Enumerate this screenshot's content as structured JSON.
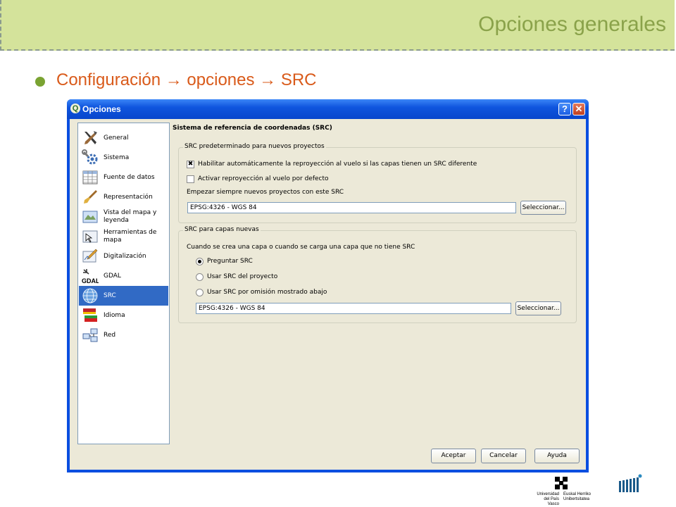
{
  "slide": {
    "title": "Opciones generales",
    "bullet": "Configuración → opciones → SRC",
    "colors": {
      "header_bg": "#d4e39b",
      "title": "#8aa24a",
      "bullet": "#d95a1a",
      "dot": "#7aa332"
    }
  },
  "window": {
    "title": "Opciones",
    "help_label": "?",
    "close_label": "✕"
  },
  "nav": {
    "items": [
      {
        "label": "General",
        "icon": "tools-icon"
      },
      {
        "label": "Sistema",
        "icon": "wrench-gear-icon"
      },
      {
        "label": "Fuente de datos",
        "icon": "table-icon"
      },
      {
        "label": "Representación",
        "icon": "brush-icon"
      },
      {
        "label": "Vista del mapa y leyenda",
        "icon": "map-view-icon"
      },
      {
        "label": "Herramientas de mapa",
        "icon": "map-tools-icon"
      },
      {
        "label": "Digitalización",
        "icon": "digitize-icon"
      },
      {
        "label": "GDAL",
        "icon": "gdal-icon"
      },
      {
        "label": "SRC",
        "icon": "globe-icon",
        "selected": true
      },
      {
        "label": "Idioma",
        "icon": "flags-icon"
      },
      {
        "label": "Red",
        "icon": "network-icon"
      }
    ]
  },
  "panel": {
    "section_title": "Sistema de referencia de coordenadas (SRC)",
    "group1": {
      "legend": "SRC predeterminado para nuevos proyectos",
      "checkbox1": {
        "label": "Habilitar automáticamente la reproyección al vuelo si las capas tienen un SRC diferente",
        "checked": true
      },
      "checkbox2": {
        "label": "Activar reproyección al vuelo por defecto",
        "checked": false
      },
      "field_label": "Empezar siempre nuevos proyectos con este SRC",
      "field_value": "EPSG:4326 - WGS 84",
      "select_button": "Seleccionar..."
    },
    "group2": {
      "legend": "SRC para capas nuevas",
      "description": "Cuando se crea una capa o cuando se carga una capa que no tiene SRC",
      "radio1": {
        "label": "Preguntar SRC",
        "selected": true
      },
      "radio2": {
        "label": "Usar SRC del proyecto",
        "selected": false
      },
      "radio3": {
        "label": "Usar SRC por omisión mostrado abajo",
        "selected": false
      },
      "field_value": "EPSG:4326 - WGS 84",
      "select_button": "Seleccionar..."
    }
  },
  "buttons": {
    "accept": "Aceptar",
    "cancel": "Cancelar",
    "help": "Ayuda"
  },
  "logos": {
    "upv_line1": "Universidad",
    "upv_line2": "del País Vasco",
    "ehu_line1": "Euskal Herriko",
    "ehu_line2": "Unibertsitatea"
  }
}
